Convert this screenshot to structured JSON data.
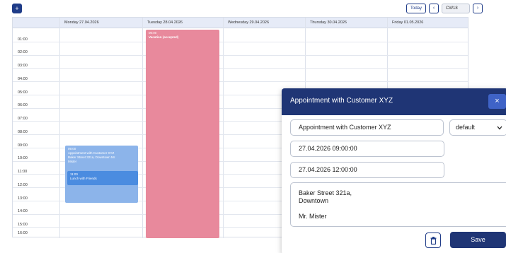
{
  "toolbar": {
    "add_label": "+",
    "today_label": "Today",
    "prev_label": "‹",
    "week_value": "CW18",
    "next_label": "›"
  },
  "calendar": {
    "days": [
      "Monday 27.04.2026",
      "Tuesday 28.04.2026",
      "Wednesday 29.04.2026",
      "Thursday 30.04.2026",
      "Friday 01.05.2026"
    ],
    "hours": [
      "01:00",
      "02:00",
      "03:00",
      "04:00",
      "05:00",
      "06:00",
      "07:00",
      "08:00",
      "09:00",
      "10:00",
      "11:00",
      "12:00",
      "13:00",
      "14:00",
      "15:00",
      "16:00"
    ],
    "events": {
      "vacation": {
        "time": "00:00",
        "title": "Vacation (accepted)",
        "color": "#e8899c"
      },
      "customer": {
        "time": "09:00",
        "title": "Appointment with Customer XYZ",
        "location": "Baker Street 321a, Downtown Mr.",
        "person": "Mister",
        "color": "#8cb4ea"
      },
      "lunch": {
        "time": "11:00",
        "title": "Lunch with Friends",
        "color": "#4b8ce0"
      }
    }
  },
  "modal": {
    "header_title": "Appointment with Customer XYZ",
    "close_label": "×",
    "title_value": "Appointment with Customer XYZ",
    "type_value": "default",
    "start_value": "27.04.2026 09:00:00",
    "end_value": "27.04.2026 12:00:00",
    "notes_value": "Baker Street 321a,\nDowntown\n\nMr. Mister",
    "save_label": "Save"
  },
  "colors": {
    "primary": "#1f3575",
    "accent": "#3f63c7",
    "header_bg": "#e6ebf7"
  }
}
